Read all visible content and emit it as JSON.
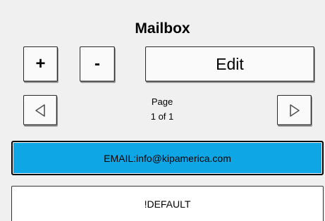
{
  "header": {
    "title": "Mailbox"
  },
  "toolbar": {
    "add_label": "+",
    "remove_label": "-",
    "edit_label": "Edit"
  },
  "pager": {
    "page_label": "Page",
    "page_value": "1 of 1",
    "prev_icon": "triangle-left-icon",
    "next_icon": "triangle-right-icon"
  },
  "mailboxes": [
    {
      "label": "EMAIL:info@kipamerica.com",
      "selected": true
    },
    {
      "label": "!DEFAULT",
      "selected": false
    }
  ],
  "colors": {
    "selected_row": "#0fa6e6",
    "background": "#f0f0f0"
  }
}
